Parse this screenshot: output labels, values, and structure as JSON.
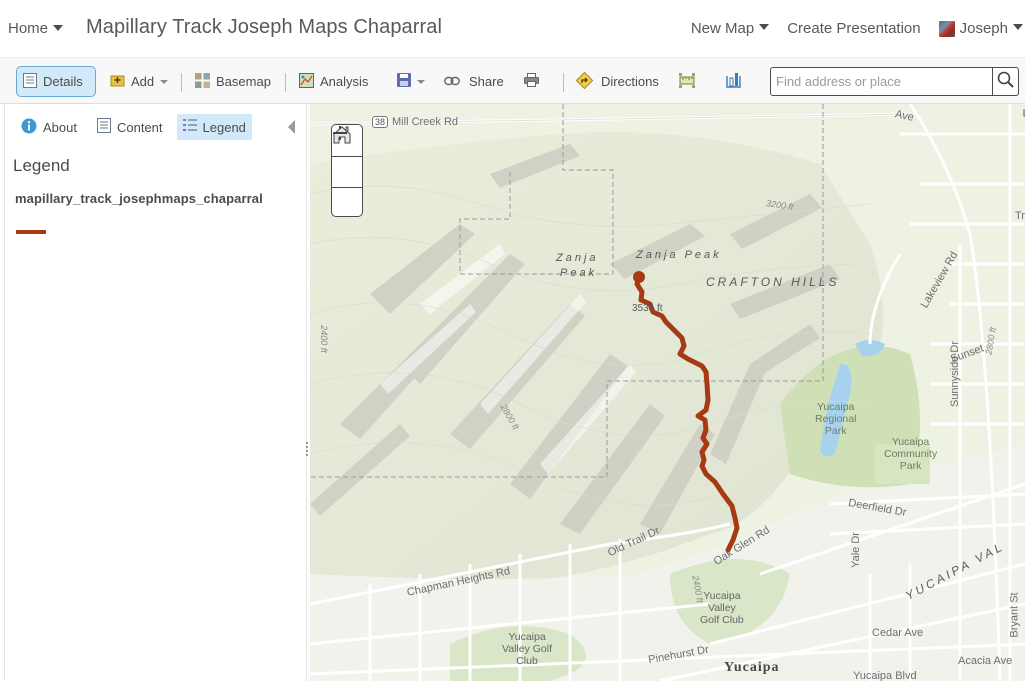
{
  "header": {
    "home_label": "Home",
    "map_title": "Mapillary Track Joseph Maps Chaparral",
    "new_map_label": "New Map",
    "create_presentation_label": "Create Presentation",
    "user_name": "Joseph"
  },
  "toolbar": {
    "details_label": "Details",
    "add_label": "Add",
    "basemap_label": "Basemap",
    "analysis_label": "Analysis",
    "share_label": "Share",
    "directions_label": "Directions",
    "search_placeholder": "Find address or place",
    "search_value": ""
  },
  "sidebar": {
    "tabs": [
      {
        "label": "About",
        "icon": "info-icon"
      },
      {
        "label": "Content",
        "icon": "content-list-icon"
      },
      {
        "label": "Legend",
        "icon": "legend-icon",
        "active": true
      }
    ],
    "legend_heading": "Legend",
    "layer_name": "mapillary_track_josephmaps_chaparral",
    "layer_color": "#a63a12"
  },
  "map": {
    "track_color": "#a63a12",
    "labels": {
      "route_shield": "38",
      "mill_creek": "Mill Creek Rd",
      "ave_fragment": "Ave",
      "tr_fragment": "Tr",
      "elev_3200": "3200 ft",
      "zanja_peak_1a": "Zanja",
      "zanja_peak_1b": "Peak",
      "zanja_peak_2": "Zanja Peak",
      "crafton_hills": "CRAFTON HILLS",
      "elev_summit": "3534 ft",
      "elev_2400": "2400 ft",
      "elev_2800": "2800 ft",
      "elev_2800_b": "2800 ft",
      "elev_2400_b": "2400 ft",
      "lakeview": "Lakeview Rd",
      "sunnyside": "Sunnyside Dr",
      "sunset": "Sunset",
      "regional_park": [
        "Yucaipa",
        "Regional",
        "Park"
      ],
      "community_park": [
        "Yucaipa",
        "Community",
        "Park"
      ],
      "deerfield": "Deerfield Dr",
      "yale": "Yale Dr",
      "yucaipa_valley": "YUCAIPA VAL",
      "bryant": "Bryant St",
      "cedar": "Cedar Ave",
      "acacia": "Acacia Ave",
      "yucaipa_blvd": "Yucaipa Blvd",
      "old_trail": "Old Trail Dr",
      "oak_glen": "Oak Glen Rd",
      "chapman": "Chapman Heights Rd",
      "golf_club_1": [
        "Yucaipa",
        "Valley",
        "Golf Club"
      ],
      "golf_club_2": [
        "Yucaipa",
        "Valley Golf",
        "Club"
      ],
      "pinehurst": "Pinehurst Dr",
      "yucaipa_city": "Yucaipa"
    }
  }
}
